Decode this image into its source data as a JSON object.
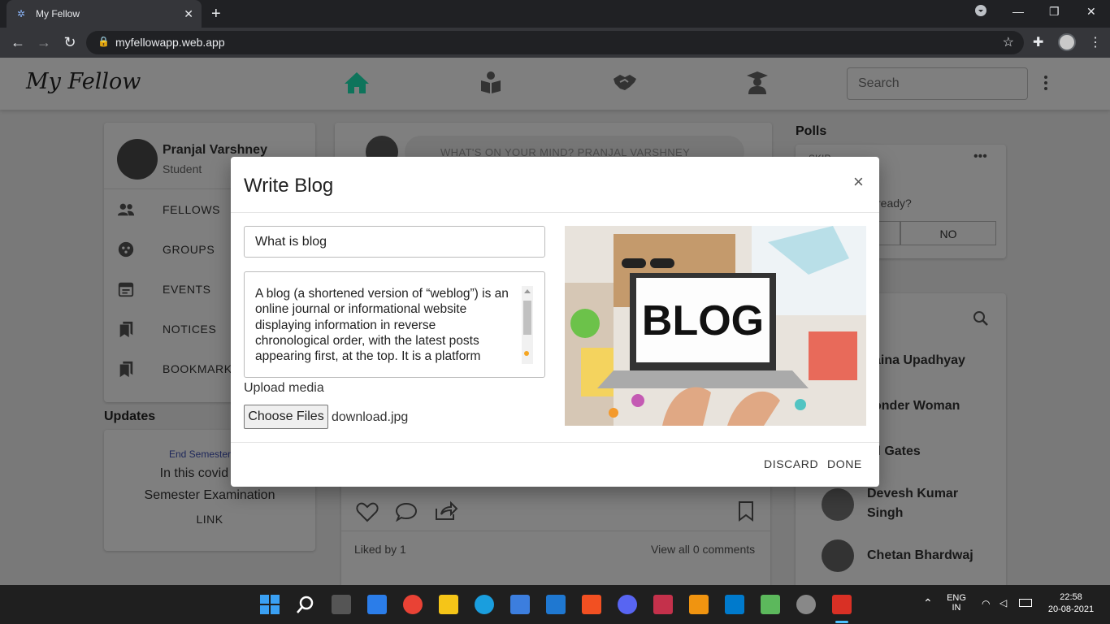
{
  "browser": {
    "tab_title": "My Fellow",
    "tab_close": "✕",
    "new_tab": "+",
    "url": "myfellowapp.web.app"
  },
  "app": {
    "logo": "My Fellow",
    "search_placeholder": "Search",
    "nav_icons": [
      "home-icon",
      "book-reader-icon",
      "handshake-icon",
      "graduate-icon"
    ],
    "accent": "#1de9b6"
  },
  "profile": {
    "name": "Pranjal Varshney",
    "role": "Student"
  },
  "menu": [
    "FELLOWS",
    "GROUPS",
    "EVENTS",
    "NOTICES",
    "BOOKMARKS"
  ],
  "updates": {
    "heading": "Updates",
    "title": "End Semester Exa",
    "line1": "In this covid situa",
    "line2": "Semester Examination",
    "link": "LINK"
  },
  "feed": {
    "composer": "WHAT'S ON YOUR MIND? PRANJAL VARSHNEY",
    "liked_by": "Liked by 1",
    "view_comments": "View all 0 comments"
  },
  "polls": {
    "heading": "Polls",
    "option_hint": "SKIP",
    "question_partial": "ready?",
    "no_label": "NO"
  },
  "fellows": [
    "aina Upadhyay",
    "onder Woman",
    "ll Gates",
    "Devesh Kumar",
    "Singh",
    "Chetan Bhardwaj"
  ],
  "modal": {
    "title": "Write Blog",
    "close": "×",
    "title_value": "What is blog",
    "body_text": "A blog (a shortened version of “weblog”) is an online journal or informational website displaying information in reverse chronological order, with the latest posts appearing first, at the top. It is a platform",
    "upload_label": "Upload media",
    "choose_files": "Choose Files",
    "file_name": "download.jpg",
    "discard": "DISCARD",
    "done": "DONE",
    "image_text": "BLOG"
  },
  "taskbar": {
    "lang1": "ENG",
    "lang2": "IN",
    "time": "22:58",
    "date": "20-08-2021"
  }
}
